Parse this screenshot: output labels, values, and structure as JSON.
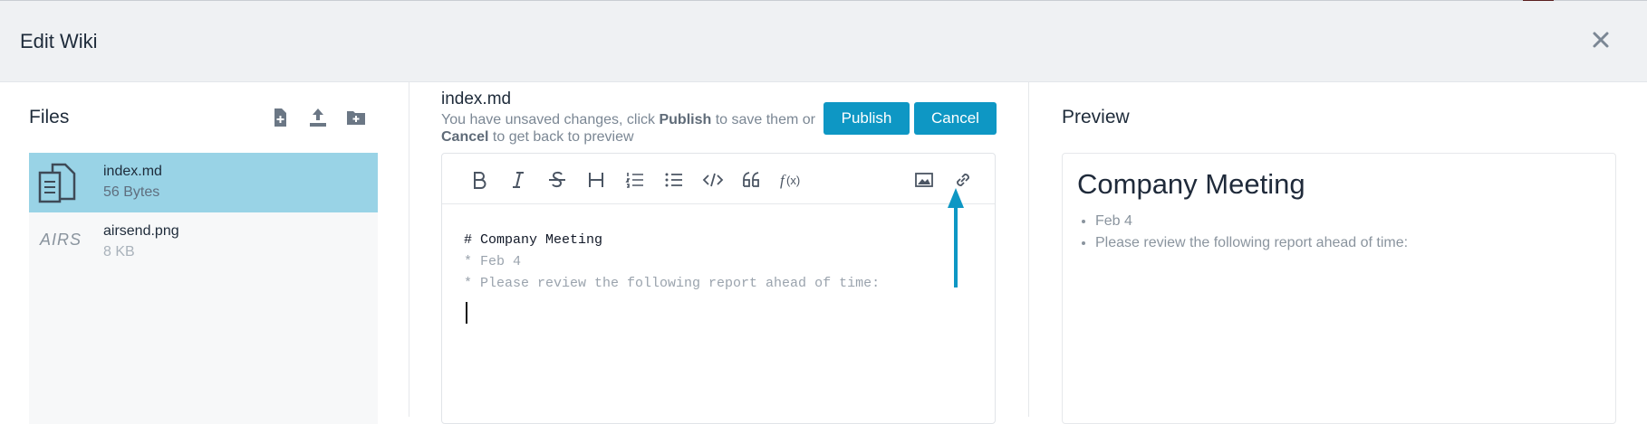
{
  "header": {
    "title": "Edit Wiki",
    "close_icon": "close-icon"
  },
  "files": {
    "title": "Files",
    "toolbar": [
      "new-file-icon",
      "upload-icon",
      "new-folder-icon"
    ],
    "items": [
      {
        "name": "index.md",
        "size": "56 Bytes",
        "selected": true,
        "icon": "document-icon"
      },
      {
        "name": "airsend.png",
        "size": "8 KB",
        "selected": false,
        "thumb": "AIRS"
      }
    ]
  },
  "editor": {
    "filename": "index.md",
    "note_pre": "You have unsaved changes, click ",
    "note_publish": "Publish",
    "note_mid": " to save them or ",
    "note_cancel": "Cancel",
    "note_post": " to get back to preview",
    "publish_label": "Publish",
    "cancel_label": "Cancel",
    "toolbar": [
      "bold-icon",
      "italic-icon",
      "strikethrough-icon",
      "heading-icon",
      "ordered-list-icon",
      "bullet-list-icon",
      "code-icon",
      "quote-icon",
      "formula-icon",
      "image-icon",
      "link-icon"
    ],
    "lines": [
      "# Company Meeting",
      "* Feb 4",
      "* Please review the following report ahead of time:"
    ],
    "accent": "#0e97c4"
  },
  "preview": {
    "title": "Preview",
    "heading": "Company Meeting",
    "bullets": [
      "Feb 4",
      "Please review the following report ahead of time:"
    ]
  }
}
